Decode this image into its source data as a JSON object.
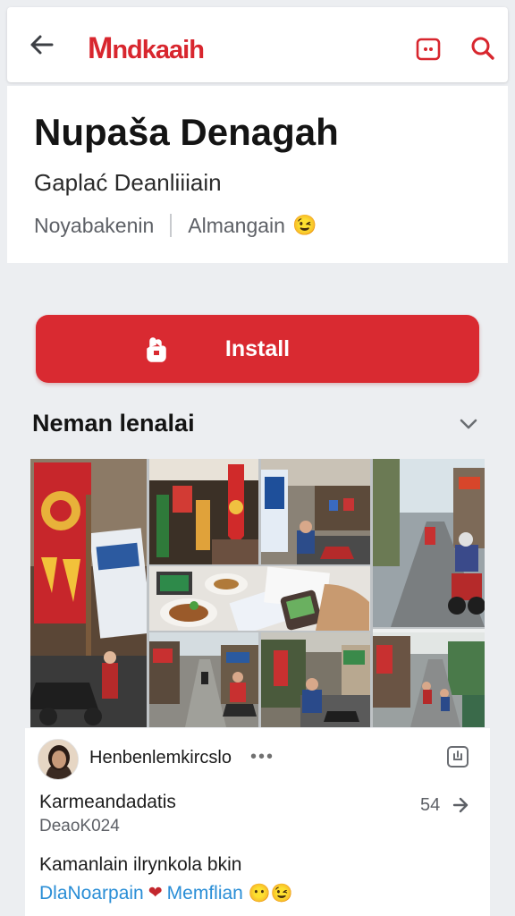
{
  "header": {
    "logo_first": "M",
    "logo_rest": "ndkaaih",
    "back_icon": "arrow-left-icon",
    "more_icon": "more-options-icon",
    "search_icon": "search-icon",
    "accent_color": "#d8262e"
  },
  "app": {
    "title": "Nupaša Denagah",
    "subtitle": "Gaplać Deanliiiain",
    "meta_left": "Noyabakenin",
    "meta_right": "Almangain",
    "meta_emoji": "😉"
  },
  "install": {
    "label": "Install",
    "icon": "install-hand-icon",
    "color": "#d92a31"
  },
  "section": {
    "title": "Neman lenalai",
    "toggle_icon": "chevron-down-icon"
  },
  "gallery": {
    "description_icons": [
      "festival-banner-image",
      "street-stalls-image",
      "shopfront-image",
      "scooter-street-image",
      "food-plates-image",
      "rider-image",
      "market-lane-image",
      "sidewalk-image",
      "traffic-image"
    ]
  },
  "post": {
    "username": "Henbenlemkircslo",
    "more": "•••",
    "action_icon": "share-box-icon",
    "heading": "Karmeandadatis",
    "date": "DeaoK024",
    "count": "54",
    "text": "Kamanlain ilrynkola bkin",
    "tag_left": "DlaNoarpain",
    "tag_heart": "❤",
    "tag_right": "Memflian",
    "tag_emoji": "😶😉"
  }
}
